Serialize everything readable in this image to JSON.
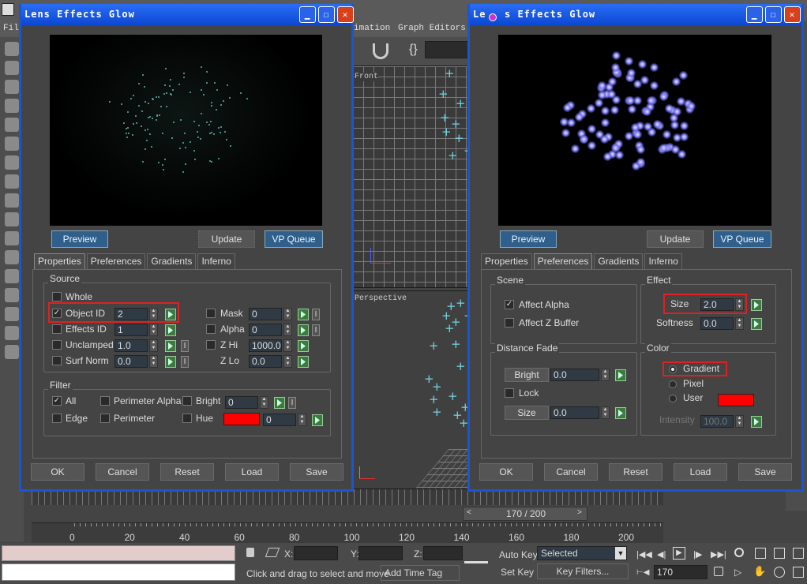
{
  "app": {
    "menu": {
      "file": "Fil",
      "animation": "imation",
      "graph_editors": "Graph Editors"
    },
    "viewports": {
      "front": "Front",
      "perspective": "Perspective"
    },
    "frame_counter": "170 / 200",
    "timeline_ticks": [
      "0",
      "20",
      "40",
      "60",
      "80",
      "100",
      "120",
      "140",
      "160",
      "180",
      "200"
    ],
    "status": {
      "x_label": "X:",
      "y_label": "Y:",
      "z_label": "Z:",
      "prompt": "Click and drag to select and move",
      "add_time_tag": "Add Time Tag",
      "auto_key": "Auto Key",
      "set_key": "Set Key",
      "selected": "Selected",
      "key_filters": "Key Filters...",
      "frame": "170"
    }
  },
  "dialog_left": {
    "title": "Lens Effects Glow",
    "buttons": {
      "preview": "Preview",
      "update": "Update",
      "vp_queue": "VP Queue"
    },
    "tabs": [
      "Properties",
      "Preferences",
      "Gradients",
      "Inferno"
    ],
    "source": {
      "title": "Source",
      "whole": "Whole",
      "object_id": "Object ID",
      "object_id_val": "2",
      "effects_id": "Effects ID",
      "effects_id_val": "1",
      "unclamped": "Unclamped",
      "unclamped_val": "1.0",
      "surf_norm": "Surf Norm",
      "surf_norm_val": "0.0",
      "mask": "Mask",
      "mask_val": "0",
      "alpha": "Alpha",
      "alpha_val": "0",
      "zhi": "Z Hi",
      "zhi_val": "1000.0",
      "zlo": "Z Lo",
      "zlo_val": "0.0",
      "i": "I"
    },
    "filter": {
      "title": "Filter",
      "all": "All",
      "edge": "Edge",
      "perimeter_alpha": "Perimeter Alpha",
      "perimeter": "Perimeter",
      "bright": "Bright",
      "bright_val": "0",
      "hue": "Hue",
      "hue_val": "0",
      "hue_color": "#ff0000"
    },
    "footer": [
      "OK",
      "Cancel",
      "Reset",
      "Load",
      "Save"
    ]
  },
  "dialog_right": {
    "title": "Lens Effects Glow",
    "title_prefix": "Le",
    "buttons": {
      "preview": "Preview",
      "update": "Update",
      "vp_queue": "VP Queue"
    },
    "tabs": [
      "Properties",
      "Preferences",
      "Gradients",
      "Inferno"
    ],
    "scene": {
      "title": "Scene",
      "affect_alpha": "Affect Alpha",
      "affect_z": "Affect Z Buffer"
    },
    "effect": {
      "title": "Effect",
      "size": "Size",
      "size_val": "2.0",
      "softness": "Softness",
      "softness_val": "0.0"
    },
    "distance_fade": {
      "title": "Distance Fade",
      "bright": "Bright",
      "bright_val": "0.0",
      "lock": "Lock",
      "size": "Size",
      "size_val": "0.0"
    },
    "color": {
      "title": "Color",
      "gradient": "Gradient",
      "pixel": "Pixel",
      "user": "User",
      "user_color": "#ff0000",
      "intensity": "Intensity",
      "intensity_val": "100.0"
    },
    "footer": [
      "OK",
      "Cancel",
      "Reset",
      "Load",
      "Save"
    ]
  }
}
